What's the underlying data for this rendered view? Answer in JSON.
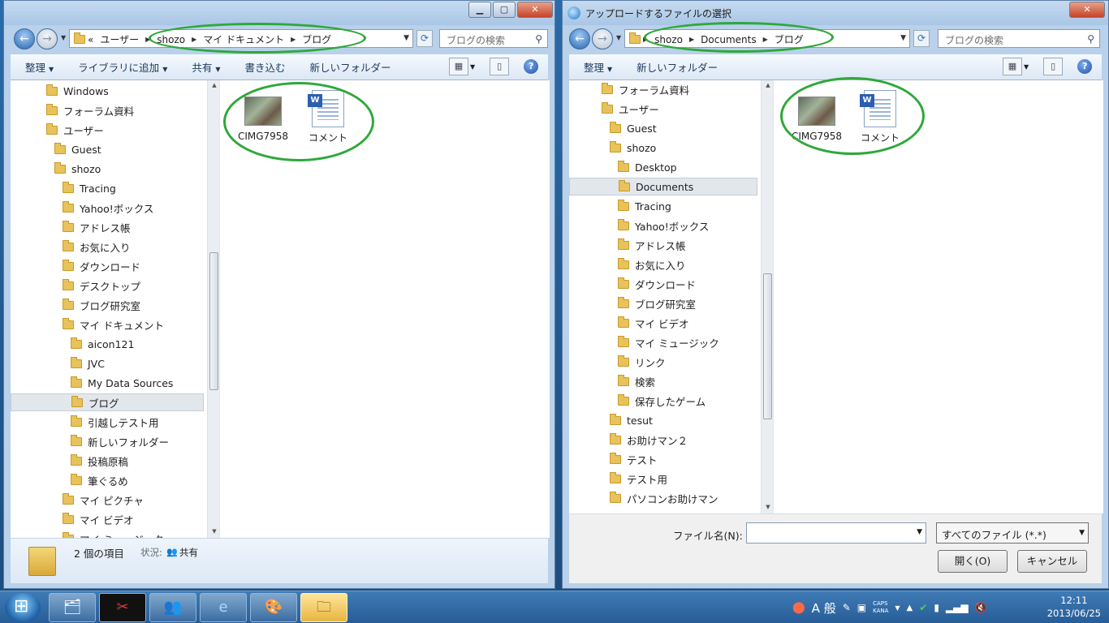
{
  "left_window": {
    "breadcrumb": [
      "ユーザー",
      "shozo",
      "マイ ドキュメント",
      "ブログ"
    ],
    "breadcrumb_prefix": "«",
    "search_placeholder": "ブログの検索",
    "toolbar": [
      "整理",
      "ライブラリに追加",
      "共有",
      "書き込む",
      "新しいフォルダー"
    ],
    "tree": [
      {
        "label": "Windows",
        "level": 0
      },
      {
        "label": "フォーラム資料",
        "level": 0
      },
      {
        "label": "ユーザー",
        "level": 0
      },
      {
        "label": "Guest",
        "level": 1
      },
      {
        "label": "shozo",
        "level": 1
      },
      {
        "label": "Tracing",
        "level": 2
      },
      {
        "label": "Yahoo!ボックス",
        "level": 2
      },
      {
        "label": "アドレス帳",
        "level": 2
      },
      {
        "label": "お気に入り",
        "level": 2
      },
      {
        "label": "ダウンロード",
        "level": 2
      },
      {
        "label": "デスクトップ",
        "level": 2
      },
      {
        "label": "ブログ研究室",
        "level": 2
      },
      {
        "label": "マイ ドキュメント",
        "level": 2
      },
      {
        "label": "aicon121",
        "level": 3
      },
      {
        "label": "JVC",
        "level": 3
      },
      {
        "label": "My Data Sources",
        "level": 3
      },
      {
        "label": "ブログ",
        "level": 3,
        "selected": true
      },
      {
        "label": "引越しテスト用",
        "level": 3
      },
      {
        "label": "新しいフォルダー",
        "level": 3
      },
      {
        "label": "投稿原稿",
        "level": 3
      },
      {
        "label": "筆ぐるめ",
        "level": 3
      },
      {
        "label": "マイ ピクチャ",
        "level": 2
      },
      {
        "label": "マイ ビデオ",
        "level": 2
      },
      {
        "label": "マイ ミュージック",
        "level": 2
      }
    ],
    "files": [
      "CIMG7958",
      "コメント"
    ],
    "details": {
      "count": "2 個の項目",
      "status_label": "状況:",
      "status_value": "共有"
    }
  },
  "right_window": {
    "title": "アップロードするファイルの選択",
    "breadcrumb": [
      "shozo",
      "Documents",
      "ブログ"
    ],
    "search_placeholder": "ブログの検索",
    "toolbar": [
      "整理",
      "新しいフォルダー"
    ],
    "tree": [
      {
        "label": "フォーラム資料",
        "level": 0
      },
      {
        "label": "ユーザー",
        "level": 0
      },
      {
        "label": "Guest",
        "level": 1
      },
      {
        "label": "shozo",
        "level": 1
      },
      {
        "label": "Desktop",
        "level": 2
      },
      {
        "label": "Documents",
        "level": 2,
        "selected": true
      },
      {
        "label": "Tracing",
        "level": 2
      },
      {
        "label": "Yahoo!ボックス",
        "level": 2
      },
      {
        "label": "アドレス帳",
        "level": 2
      },
      {
        "label": "お気に入り",
        "level": 2
      },
      {
        "label": "ダウンロード",
        "level": 2
      },
      {
        "label": "ブログ研究室",
        "level": 2
      },
      {
        "label": "マイ ビデオ",
        "level": 2
      },
      {
        "label": "マイ ミュージック",
        "level": 2
      },
      {
        "label": "リンク",
        "level": 2
      },
      {
        "label": "検索",
        "level": 2
      },
      {
        "label": "保存したゲーム",
        "level": 2
      },
      {
        "label": "tesut",
        "level": 1
      },
      {
        "label": "お助けマン２",
        "level": 1
      },
      {
        "label": "テスト",
        "level": 1
      },
      {
        "label": "テスト用",
        "level": 1
      },
      {
        "label": "パソコンお助けマン",
        "level": 1
      }
    ],
    "files": [
      "CIMG7958",
      "コメント"
    ],
    "filename_label": "ファイル名(N):",
    "filename_value": "",
    "filetype": "すべてのファイル (*.*)",
    "open_button": "開く(O)",
    "cancel_button": "キャンセル"
  },
  "tray": {
    "ime": "A 般",
    "caps": "CAPS",
    "kana": "KANA",
    "time": "12:11",
    "date": "2013/06/25"
  },
  "colors": {
    "highlight": "#2ea83a",
    "taskbar": "#285d97"
  }
}
